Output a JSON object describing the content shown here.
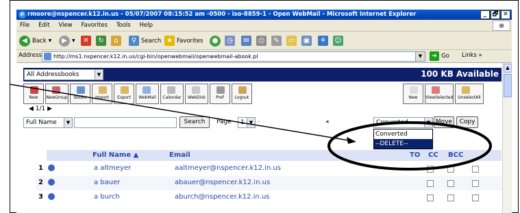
{
  "window": {
    "title": "rmoore@nspencer.k12.in.us - 05/07/2007 08:15:52 am -0500 - iso-8859-1 - Open WebMail - Microsoft Internet Explorer",
    "controls": [
      "_",
      "🗗",
      "✕"
    ]
  },
  "menu": [
    "File",
    "Edit",
    "View",
    "Favorites",
    "Tools",
    "Help"
  ],
  "toolbar": {
    "back": "Back",
    "search": "Search",
    "favorites": "Favorites"
  },
  "address": {
    "label": "Address",
    "url": "http://ms1.nspencer.k12.in.us/cgi-bin/openwebmail/openwebmail-abook.pl",
    "go": "Go",
    "links": "Links"
  },
  "app": {
    "addressbook_select": "All Addressbooks",
    "quota": "100 KB Available",
    "buttons_left": [
      "New",
      "NewGroup",
      "Books",
      "Import",
      "Export",
      "WebMail",
      "Calendar",
      "WebDisk",
      "Pref",
      "Logout"
    ],
    "buttons_right": [
      "New",
      "ViewSelected",
      "UnselectAll"
    ],
    "pager": "◀ 1/1 ▶",
    "search_field": "Full Name",
    "search_button": "Search",
    "page_label": "Page",
    "page_value": "1",
    "dash": "-",
    "convert_select": "Converted",
    "move_button": "Move",
    "copy_button": "Copy",
    "options": [
      "Converted",
      "--DELETE--"
    ],
    "headers": {
      "fullname": "Full Name ▲",
      "email": "Email",
      "to": "TO",
      "cc": "CC",
      "bcc": "BCC"
    },
    "contacts": [
      {
        "num": "1",
        "name": "a altmeyer",
        "email": "aaltmeyer@nspencer.k12.in.us"
      },
      {
        "num": "2",
        "name": "a bauer",
        "email": "abauer@nspencer.k12.in.us"
      },
      {
        "num": "3",
        "name": "a burch",
        "email": "aburch@nspencer.k12.in.us"
      }
    ]
  },
  "colors": {
    "titlebar": "#0446b3",
    "quota_bar": "#0d1e6b",
    "link": "#2a4aa8",
    "selection": "#0a246a"
  }
}
